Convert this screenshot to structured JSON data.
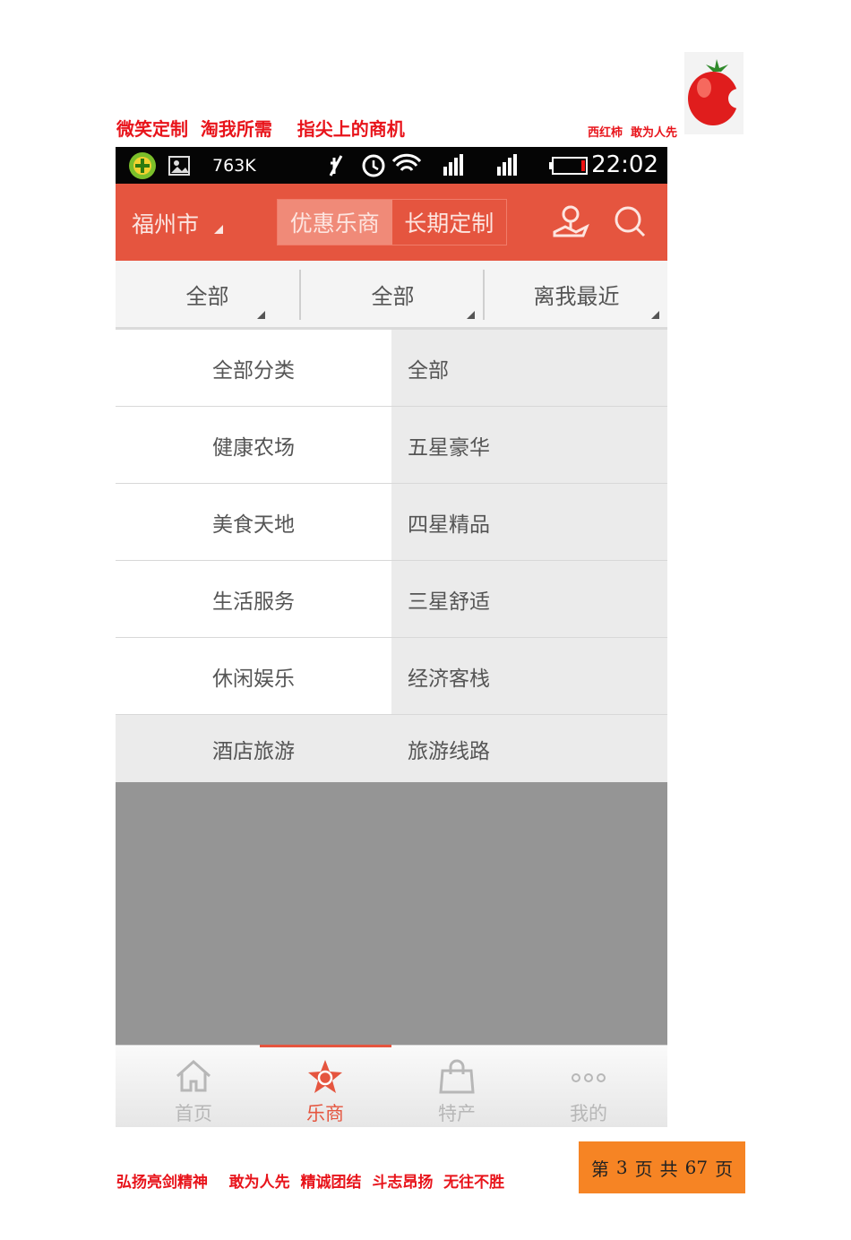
{
  "header": {
    "slogan_left": "微笑定制  淘我所需    指尖上的商机",
    "slogan_right": "西红柿  敢为人先"
  },
  "footer": {
    "slogan": "弘扬亮剑精神    敢为人先  精诚团结  斗志昂扬  无往不胜",
    "page": {
      "prefix": "第",
      "current": "3",
      "mid1": "页",
      "mid2": "共",
      "total": "67",
      "suffix": "页"
    }
  },
  "status_bar": {
    "speed": "763K",
    "time": "22:02"
  },
  "app_bar": {
    "city": "福州市",
    "tabs": [
      {
        "label": "优惠乐商",
        "active": true
      },
      {
        "label": "长期定制",
        "active": false
      }
    ],
    "icons": [
      "location-icon",
      "search-icon"
    ]
  },
  "filters": [
    {
      "label": "全部"
    },
    {
      "label": "全部"
    },
    {
      "label": "离我最近"
    }
  ],
  "categories": [
    {
      "left": "全部分类",
      "right": "全部"
    },
    {
      "left": "健康农场",
      "right": "五星豪华"
    },
    {
      "left": "美食天地",
      "right": "四星精品"
    },
    {
      "left": "生活服务",
      "right": "三星舒适"
    },
    {
      "left": "休闲娱乐",
      "right": "经济客栈"
    },
    {
      "left": "酒店旅游",
      "right": "旅游线路"
    }
  ],
  "bottom_tabs": [
    {
      "label": "首页",
      "icon": "home-icon",
      "active": false
    },
    {
      "label": "乐商",
      "icon": "star-shop-icon",
      "active": true
    },
    {
      "label": "特产",
      "icon": "shopping-bag-icon",
      "active": false
    },
    {
      "label": "我的",
      "icon": "more-dots-icon",
      "active": false
    }
  ],
  "colors": {
    "brand": "#e5553f",
    "slogan": "#e8141b",
    "page_badge": "#f68424"
  }
}
